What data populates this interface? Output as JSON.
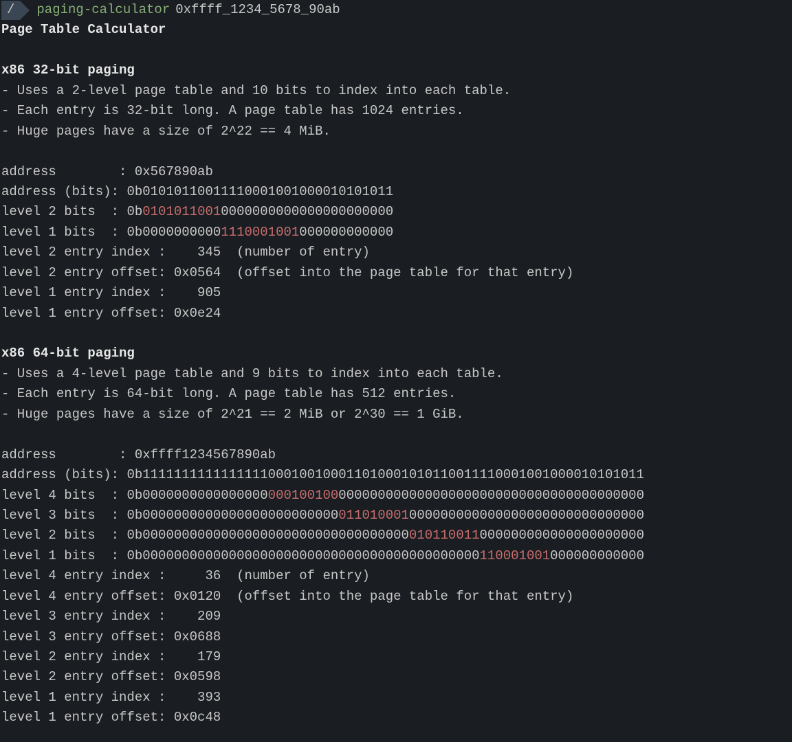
{
  "prompt": {
    "path": "/",
    "command": "paging-calculator",
    "argument": "0xffff_1234_5678_90ab"
  },
  "title": "Page Table Calculator",
  "x86_32": {
    "heading": "x86 32-bit paging",
    "bullets": [
      "- Uses a 2-level page table and 10 bits to index into each table.",
      "- Each entry is 32-bit long. A page table has 1024 entries.",
      "- Huge pages have a size of 2^22 == 4 MiB."
    ],
    "addr_label": "address        : ",
    "addr_value": "0x567890ab",
    "addrbits_label": "address (bits): ",
    "addrbits_value": "0b01010110011110001001000010101011",
    "l2bits_label": "level 2 bits  : ",
    "l2bits_pre": "0b",
    "l2bits_hl": "0101011001",
    "l2bits_post": "0000000000000000000000",
    "l1bits_label": "level 1 bits  : ",
    "l1bits_pre": "0b0000000000",
    "l1bits_hl": "1110001001",
    "l1bits_post": "000000000000",
    "l2idx_label": "level 2 entry index : ",
    "l2idx_val": "   345",
    "l2idx_note": "  (number of entry)",
    "l2off_label": "level 2 entry offset: ",
    "l2off_val": "0x0564",
    "l2off_note": "  (offset into the page table for that entry)",
    "l1idx_label": "level 1 entry index : ",
    "l1idx_val": "   905",
    "l1off_label": "level 1 entry offset: ",
    "l1off_val": "0x0e24"
  },
  "x86_64": {
    "heading": "x86 64-bit paging",
    "bullets": [
      "- Uses a 4-level page table and 9 bits to index into each table.",
      "- Each entry is 64-bit long. A page table has 512 entries.",
      "- Huge pages have a size of 2^21 == 2 MiB or 2^30 == 1 GiB."
    ],
    "addr_label": "address        : ",
    "addr_value": "0xffff1234567890ab",
    "addrbits_label": "address (bits): ",
    "addrbits_value": "0b1111111111111111000100100011010001010110011110001001000010101011",
    "l4bits_label": "level 4 bits  : ",
    "l4bits_pre": "0b0000000000000000",
    "l4bits_hl": "000100100",
    "l4bits_post": "000000000000000000000000000000000000000",
    "l3bits_label": "level 3 bits  : ",
    "l3bits_pre": "0b0000000000000000000000000",
    "l3bits_hl": "011010001",
    "l3bits_post": "000000000000000000000000000000",
    "l2bits_label": "level 2 bits  : ",
    "l2bits_pre": "0b0000000000000000000000000000000000",
    "l2bits_hl": "010110011",
    "l2bits_post": "000000000000000000000",
    "l1bits_label": "level 1 bits  : ",
    "l1bits_pre": "0b0000000000000000000000000000000000000000000",
    "l1bits_hl": "110001001",
    "l1bits_post": "000000000000",
    "l4idx_label": "level 4 entry index : ",
    "l4idx_val": "    36",
    "l4idx_note": "  (number of entry)",
    "l4off_label": "level 4 entry offset: ",
    "l4off_val": "0x0120",
    "l4off_note": "  (offset into the page table for that entry)",
    "l3idx_label": "level 3 entry index : ",
    "l3idx_val": "   209",
    "l3off_label": "level 3 entry offset: ",
    "l3off_val": "0x0688",
    "l2idx_label": "level 2 entry index : ",
    "l2idx_val": "   179",
    "l2off_label": "level 2 entry offset: ",
    "l2off_val": "0x0598",
    "l1idx_label": "level 1 entry index : ",
    "l1idx_val": "   393",
    "l1off_label": "level 1 entry offset: ",
    "l1off_val": "0x0c48"
  }
}
